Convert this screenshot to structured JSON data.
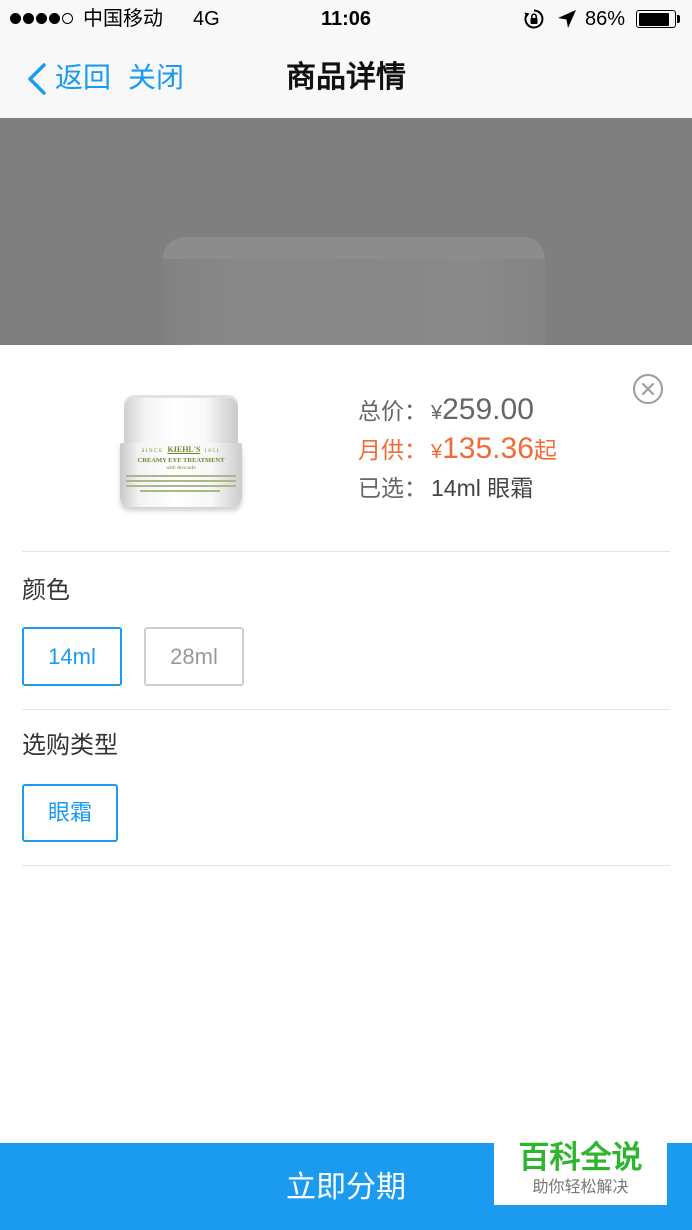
{
  "status_bar": {
    "signal": {
      "filled": 4,
      "total": 5
    },
    "carrier": "中国移动",
    "network": "4G",
    "time": "11:06",
    "battery_text": "86%",
    "battery_level": 0.86,
    "icons": [
      "rotation-lock-icon",
      "location-arrow-icon",
      "battery-icon"
    ]
  },
  "nav": {
    "back_icon": "chevron-left-icon",
    "back_label": "返回",
    "close_label": "关闭",
    "title": "商品详情"
  },
  "product": {
    "image_label": {
      "since": "SINCE",
      "brand": "KIEHL'S",
      "year": "1851",
      "name": "CREAMY EYE TREATMENT",
      "subname": "with Avocado"
    },
    "total": {
      "label": "总价：",
      "currency": "¥",
      "value": "259.00"
    },
    "monthly": {
      "label": "月供：",
      "currency": "¥",
      "value": "135.36",
      "suffix": "起"
    },
    "selected": {
      "label": "已选：",
      "value": "14ml 眼霜"
    },
    "close_icon": "close-circle-icon"
  },
  "spec_groups": [
    {
      "title": "颜色",
      "options": [
        {
          "label": "14ml",
          "selected": true
        },
        {
          "label": "28ml",
          "selected": false
        }
      ]
    },
    {
      "title": "选购类型",
      "options": [
        {
          "label": "眼霜",
          "selected": true
        }
      ]
    }
  ],
  "cta": {
    "label": "立即分期"
  },
  "watermark": {
    "title": "百科全说",
    "subtitle": "助你轻松解决"
  },
  "colors": {
    "accent": "#1A9BF0",
    "price_orange": "#F26B35",
    "watermark_green": "#2DB52D",
    "overlay": "#7F7F7F"
  }
}
